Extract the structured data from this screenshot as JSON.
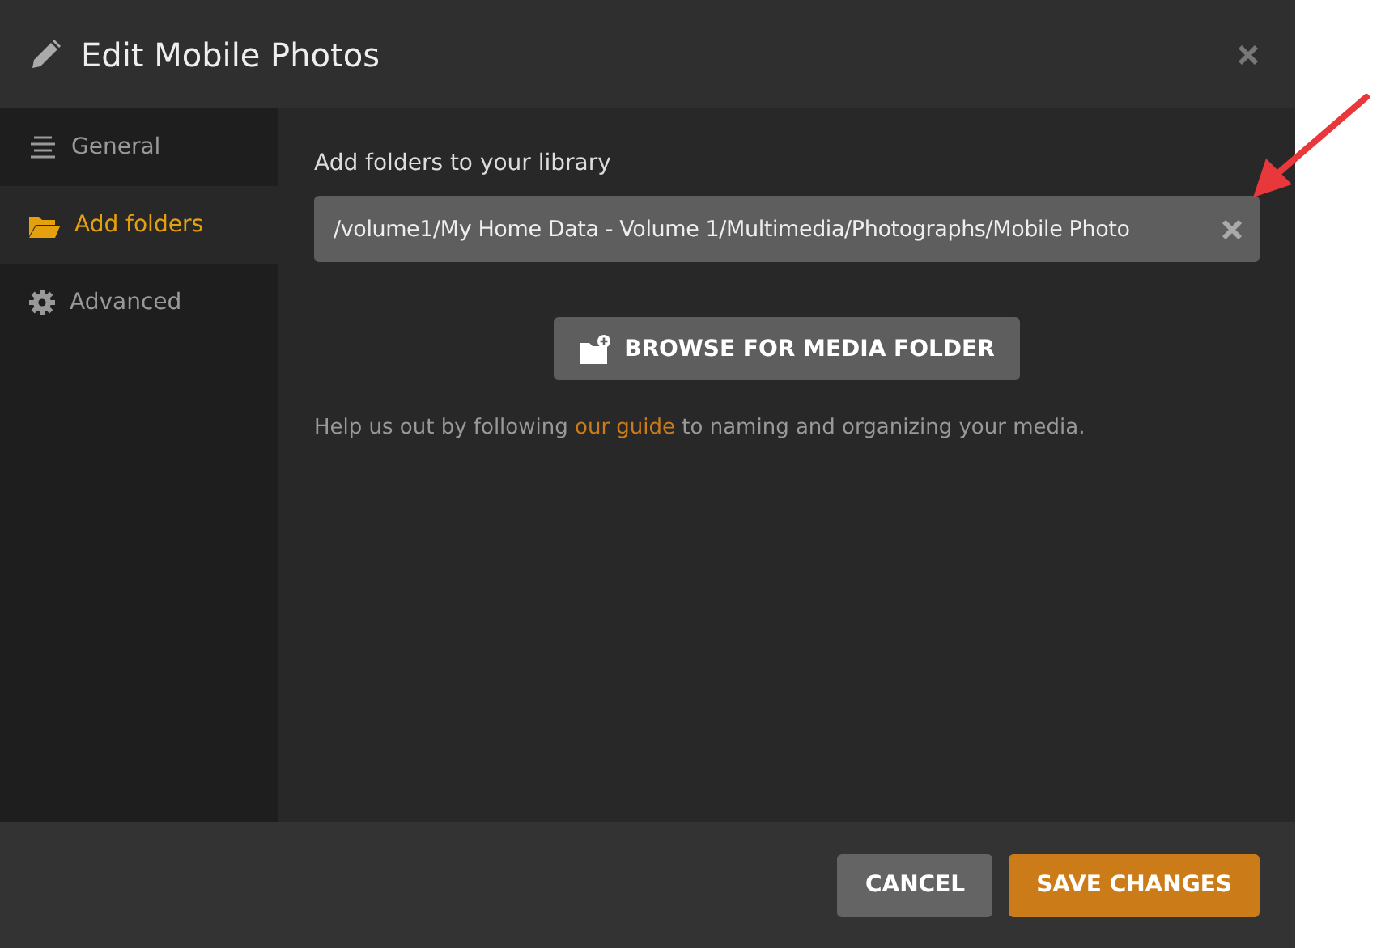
{
  "dialog": {
    "title": "Edit Mobile Photos"
  },
  "sidebar": {
    "items": [
      {
        "label": "General",
        "kind": "lines",
        "selected": false
      },
      {
        "label": "Add folders",
        "kind": "folder",
        "selected": true
      },
      {
        "label": "Advanced",
        "kind": "gear",
        "selected": false
      }
    ]
  },
  "content": {
    "heading": "Add folders to your library",
    "folder_field": {
      "value": "/volume1/My Home Data - Volume 1/Multimedia/Photographs/Mobile Photo"
    },
    "browse_button": "BROWSE FOR MEDIA FOLDER",
    "help_text": {
      "before": "Help us out by following ",
      "link": "our guide",
      "after": " to naming and organizing your media."
    }
  },
  "footer": {
    "buttons": [
      {
        "label": "CANCEL",
        "kind": "secondary"
      },
      {
        "label": "SAVE CHANGES",
        "kind": "primary"
      }
    ]
  }
}
